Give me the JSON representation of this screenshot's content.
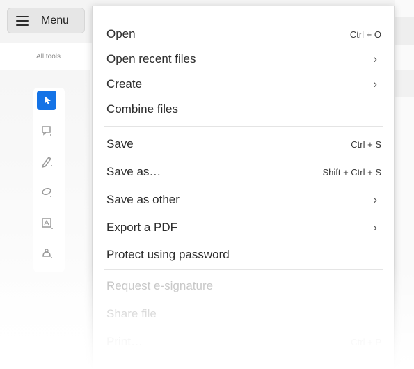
{
  "menu_button": {
    "label": "Menu",
    "icon": "hamburger-icon"
  },
  "sidebar": {
    "heading": "All tools"
  },
  "tools": [
    {
      "icon": "select-cursor-icon",
      "active": true
    },
    {
      "icon": "comment-icon",
      "active": false
    },
    {
      "icon": "pen-icon",
      "active": false
    },
    {
      "icon": "lasso-icon",
      "active": false
    },
    {
      "icon": "text-box-icon",
      "active": false
    },
    {
      "icon": "stamp-icon",
      "active": false
    }
  ],
  "menu": {
    "open": {
      "label": "Open",
      "shortcut": "Ctrl + O"
    },
    "open_recent": {
      "label": "Open recent files",
      "arrow": "›"
    },
    "create": {
      "label": "Create",
      "arrow": "›"
    },
    "combine": {
      "label": "Combine files"
    },
    "save": {
      "label": "Save",
      "shortcut": "Ctrl + S"
    },
    "save_as": {
      "label": "Save as…",
      "shortcut": "Shift + Ctrl + S"
    },
    "save_as_other": {
      "label": "Save as other",
      "arrow": "›"
    },
    "export_pdf": {
      "label": "Export a PDF",
      "arrow": "›"
    },
    "protect": {
      "label": "Protect using password"
    },
    "request_esign": {
      "label": "Request e-signature"
    },
    "share": {
      "label": "Share file"
    },
    "print": {
      "label": "Print…",
      "shortcut": "Ctrl + P"
    }
  },
  "colors": {
    "accent": "#1473e6",
    "disabled_text": "#b9b9b9"
  }
}
